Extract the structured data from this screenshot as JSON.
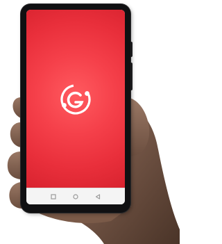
{
  "scene": {
    "description_free": true
  },
  "app_screen": {
    "logo_icon": "brand-g-orbit-icon",
    "background_color": "#ef3a44",
    "logo_color": "#ffffff"
  },
  "navigation_bar": {
    "buttons": [
      {
        "icon": "recents-square-icon"
      },
      {
        "icon": "home-circle-icon"
      },
      {
        "icon": "back-triangle-icon"
      }
    ],
    "color": "#9a9a9a"
  }
}
